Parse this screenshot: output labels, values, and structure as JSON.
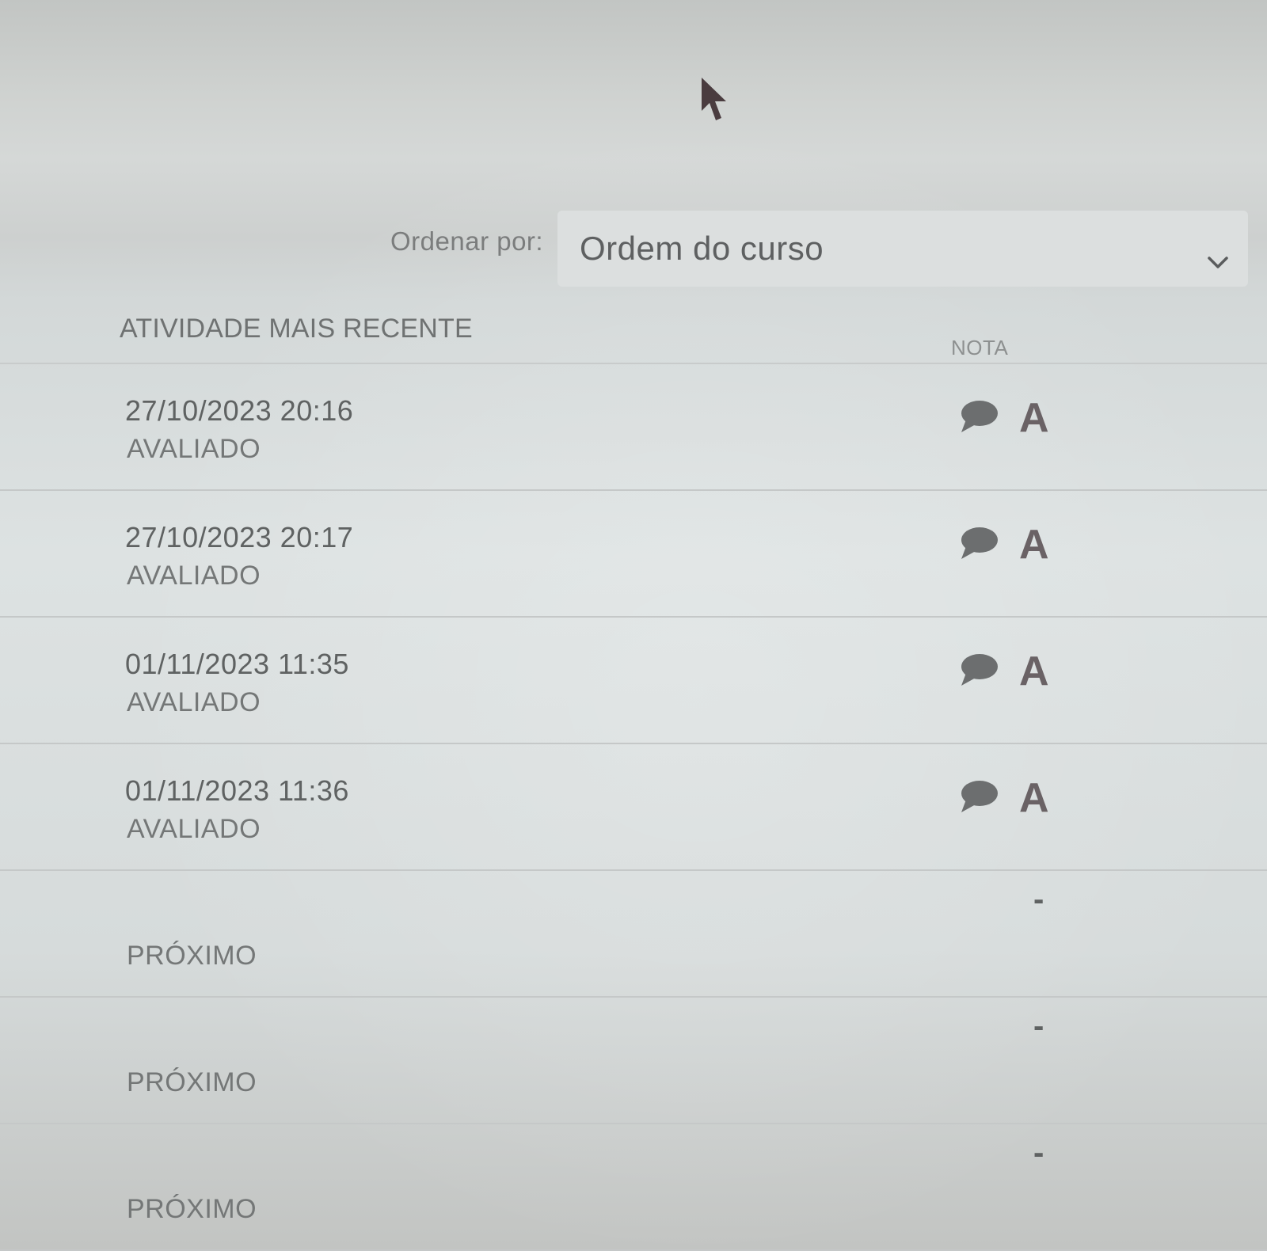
{
  "sort": {
    "label": "Ordenar por:",
    "selected": "Ordem do curso"
  },
  "table": {
    "headers": {
      "activity": "ATIVIDADE MAIS RECENTE",
      "grade": "NOTA"
    },
    "rows": [
      {
        "date": "27/10/2023 20:16",
        "status": "AVALIADO",
        "grade": "A",
        "has_comment": true
      },
      {
        "date": "27/10/2023 20:17",
        "status": "AVALIADO",
        "grade": "A",
        "has_comment": true
      },
      {
        "date": "01/11/2023 11:35",
        "status": "AVALIADO",
        "grade": "A",
        "has_comment": true
      },
      {
        "date": "01/11/2023 11:36",
        "status": "AVALIADO",
        "grade": "A",
        "has_comment": true
      },
      {
        "date": "",
        "status": "PRÓXIMO",
        "grade": "-",
        "has_comment": false
      },
      {
        "date": "",
        "status": "PRÓXIMO",
        "grade": "-",
        "has_comment": false
      },
      {
        "date": "",
        "status": "PRÓXIMO",
        "grade": "-",
        "has_comment": false
      }
    ]
  },
  "icons": {
    "cursor": "mouse-pointer-icon",
    "chevron": "chevron-down-icon",
    "comment": "comment-icon"
  },
  "colors": {
    "comment_icon": "#6c6e6f",
    "grade_text": "#6a6265"
  }
}
